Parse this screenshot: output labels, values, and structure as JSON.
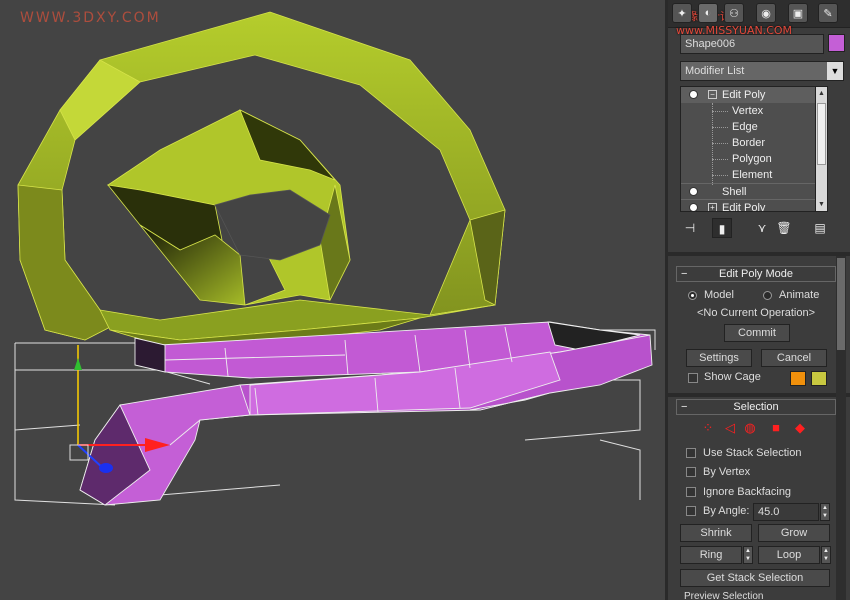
{
  "viewport": {
    "watermark": "WWW.3DXY.COM"
  },
  "panel": {
    "watermark_cn": "思缘设计论坛 www.MISSYUAN.COM",
    "tabs": [
      "create-icon",
      "modify-icon",
      "hierarchy-icon",
      "motion-icon",
      "display-icon",
      "utilities-icon"
    ],
    "object_name": "Shape006",
    "object_color": "#c45fd6",
    "modifier_list": "Modifier List",
    "stack": [
      {
        "label": "Edit Poly",
        "type": "modifier",
        "expanded": true
      },
      {
        "label": "Vertex",
        "type": "sub"
      },
      {
        "label": "Edge",
        "type": "sub"
      },
      {
        "label": "Border",
        "type": "sub"
      },
      {
        "label": "Polygon",
        "type": "sub"
      },
      {
        "label": "Element",
        "type": "sub"
      },
      {
        "label": "Shell",
        "type": "modifier"
      },
      {
        "label": "Edit Poly",
        "type": "modifier",
        "expanded": false
      }
    ],
    "edit_poly_mode": {
      "title": "Edit Poly Mode",
      "model": "Model",
      "animate": "Animate",
      "current_op": "<No Current Operation>",
      "commit": "Commit",
      "settings": "Settings",
      "cancel": "Cancel",
      "show_cage": "Show Cage",
      "cage_color_1": "#f0900c",
      "cage_color_2": "#c8c840"
    },
    "selection": {
      "title": "Selection",
      "use_stack": "Use Stack Selection",
      "by_vertex": "By Vertex",
      "ignore_backfacing": "Ignore Backfacing",
      "by_angle": "By Angle:",
      "angle_value": "45.0",
      "shrink": "Shrink",
      "grow": "Grow",
      "ring": "Ring",
      "loop": "Loop",
      "get_stack": "Get Stack Selection",
      "preview": "Preview Selection"
    }
  }
}
